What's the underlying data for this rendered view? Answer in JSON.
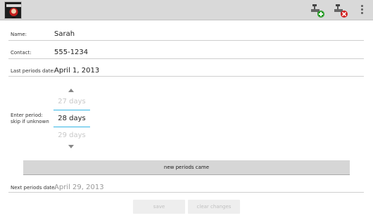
{
  "actionbar": {
    "app_icon": "app-logo-icon",
    "add_icon": "faucet-add-icon",
    "delete_icon": "faucet-delete-icon",
    "overflow_icon": "overflow-menu-icon",
    "add_color": "#2e9e2e",
    "delete_color": "#d32020"
  },
  "form": {
    "name_label": "Name:",
    "name_value": "Sarah",
    "contact_label": "Contact:",
    "contact_value": "555-1234",
    "last_label": "Last periods date:",
    "last_value": "April 1, 2013"
  },
  "picker": {
    "label_line1": "Enter period:",
    "label_line2": "skip if unknown",
    "prev": "27 days",
    "current": "28 days",
    "next": "29 days",
    "accent": "#33b5e5"
  },
  "new_periods_button": "new periods came",
  "next_periods": {
    "label": "Next periods date:",
    "value": "April 29, 2013"
  },
  "buttons": {
    "save": "save",
    "clear": "clear changes"
  }
}
